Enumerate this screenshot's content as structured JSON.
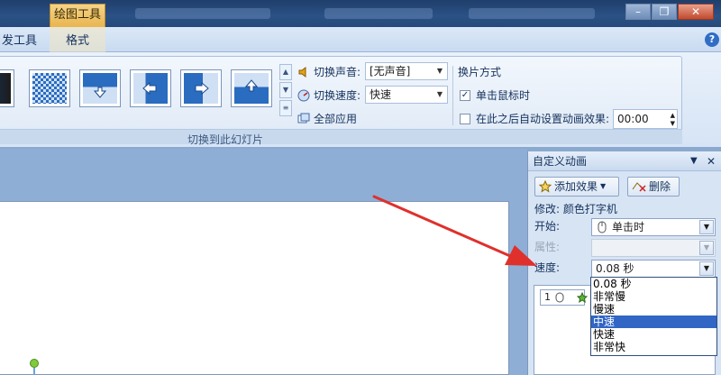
{
  "titlebar": {
    "context_tab_group": "绘图工具",
    "window_buttons": [
      "minimize",
      "restore",
      "close"
    ]
  },
  "ribbon_tabs": {
    "dev_tab": "发工具",
    "format_tab": "格式",
    "help_glyph": "?"
  },
  "ribbon": {
    "group_label": "切换到此幻灯片",
    "transition_sound_label": "切换声音:",
    "transition_sound_value": "[无声音]",
    "transition_speed_label": "切换速度:",
    "transition_speed_value": "快速",
    "apply_all_label": "全部应用",
    "advance_title": "换片方式",
    "on_click_label": "单击鼠标时",
    "on_click_checked": true,
    "auto_after_label": "在此之后自动设置动画效果:",
    "auto_after_checked": false,
    "auto_after_value": "00:00"
  },
  "task_pane": {
    "title": "自定义动画",
    "add_effect_label": "添加效果",
    "remove_label": "删除",
    "modify_label": "修改: 颜色打字机",
    "start_label": "开始:",
    "start_value": "单击时",
    "property_label": "属性:",
    "speed_label": "速度:",
    "speed_value": "0.08 秒",
    "list_item_number": "1"
  },
  "speed_dropdown": {
    "options": [
      "0.08 秒",
      "非常慢",
      "慢速",
      "中速",
      "快速",
      "非常快"
    ],
    "highlighted_index": 3
  },
  "colors": {
    "accent": "#3166c5",
    "annotation_arrow": "#e0302c",
    "title_bar": "#2b5286"
  }
}
